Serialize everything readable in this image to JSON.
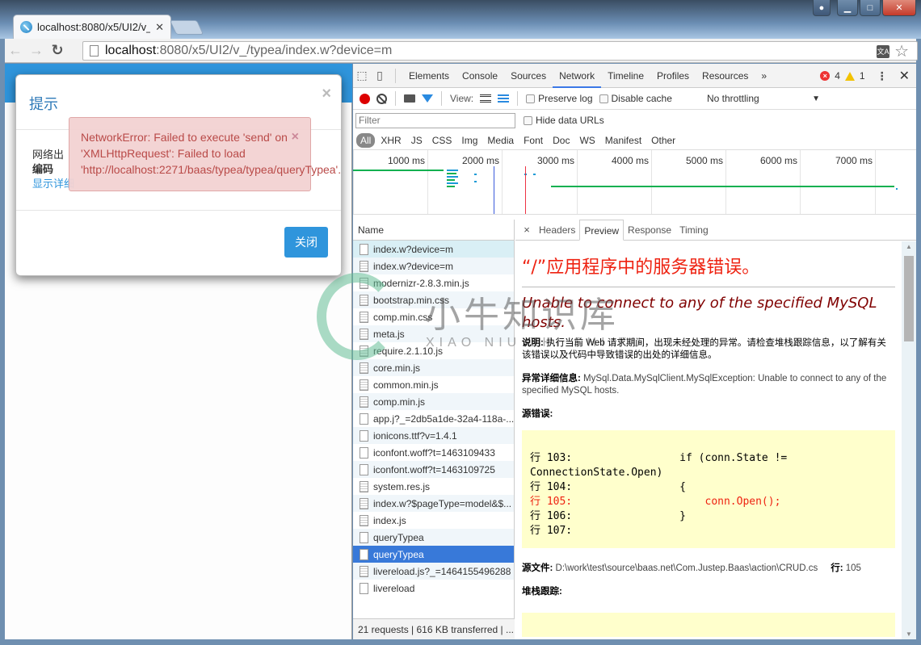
{
  "browser": {
    "tab_title": "localhost:8080/x5/UI2/v_",
    "url_host": "localhost",
    "url_rest": ":8080/x5/UI2/v_/typea/index.w?device=m",
    "translate_icon": "translate-icon",
    "bookmark_icon": "star-icon",
    "menu_icon": "hamburger-menu-icon"
  },
  "page": {
    "modal": {
      "title": "提示",
      "body_line1": "网络出",
      "body_line2_bold": "编码",
      "show_details_link": "显示详细",
      "close_button": "关闭"
    },
    "toast": {
      "message": "NetworkError: Failed to execute 'send' on 'XMLHttpRequest': Failed to load 'http://localhost:2271/baas/typea/typea/queryTypea'.",
      "close": "×"
    }
  },
  "devtools": {
    "tabs": [
      "Elements",
      "Console",
      "Sources",
      "Network",
      "Timeline",
      "Profiles",
      "Resources"
    ],
    "active_tab": "Network",
    "more_tabs": "»",
    "error_count": "4",
    "warning_count": "1",
    "network": {
      "view_label": "View:",
      "preserve_log": "Preserve log",
      "disable_cache": "Disable cache",
      "throttling": "No throttling",
      "filter_placeholder": "Filter",
      "hide_data_urls": "Hide data URLs",
      "types": [
        "All",
        "XHR",
        "JS",
        "CSS",
        "Img",
        "Media",
        "Font",
        "Doc",
        "WS",
        "Manifest",
        "Other"
      ],
      "active_type": "All",
      "timeline_ticks": [
        "1000 ms",
        "2000 ms",
        "3000 ms",
        "4000 ms",
        "5000 ms",
        "6000 ms",
        "7000 ms"
      ],
      "name_header": "Name",
      "requests": [
        {
          "name": "index.w?device=m",
          "icon": "blank"
        },
        {
          "name": "index.w?device=m",
          "icon": "doc"
        },
        {
          "name": "modernizr-2.8.3.min.js",
          "icon": "doc"
        },
        {
          "name": "bootstrap.min.css",
          "icon": "doc"
        },
        {
          "name": "comp.min.css",
          "icon": "doc"
        },
        {
          "name": "meta.js",
          "icon": "doc"
        },
        {
          "name": "require.2.1.10.js",
          "icon": "doc"
        },
        {
          "name": "core.min.js",
          "icon": "doc"
        },
        {
          "name": "common.min.js",
          "icon": "doc"
        },
        {
          "name": "comp.min.js",
          "icon": "doc"
        },
        {
          "name": "app.j?_=2db5a1de-32a4-118a-...",
          "icon": "blank"
        },
        {
          "name": "ionicons.ttf?v=1.4.1",
          "icon": "blank"
        },
        {
          "name": "iconfont.woff?t=1463109433",
          "icon": "blank"
        },
        {
          "name": "iconfont.woff?t=1463109725",
          "icon": "blank"
        },
        {
          "name": "system.res.js",
          "icon": "doc"
        },
        {
          "name": "index.w?$pageType=model&$...",
          "icon": "doc"
        },
        {
          "name": "index.js",
          "icon": "doc"
        },
        {
          "name": "queryTypea",
          "icon": "blank"
        },
        {
          "name": "queryTypea",
          "icon": "blank",
          "selected": true
        },
        {
          "name": "livereload.js?_=1464155496288",
          "icon": "doc"
        },
        {
          "name": "livereload",
          "icon": "blank"
        }
      ],
      "summary": "21 requests  |  616 KB transferred  |  ...",
      "detail_tabs": [
        "Headers",
        "Preview",
        "Response",
        "Timing"
      ],
      "active_detail_tab": "Preview"
    },
    "preview": {
      "heading": "“/”应用程序中的服务器错误。",
      "subheading": "Unable to connect to any of the specified MySQL hosts.",
      "desc_label": "说明:",
      "desc_text": "执行当前 Web 请求期间，出现未经处理的异常。请检查堆栈跟踪信息，以了解有关该错误以及代码中导致错误的出处的详细信息。",
      "exception_label": "异常详细信息:",
      "exception_text": "MySql.Data.MySqlClient.MySqlException: Unable to connect to any of the specified MySQL hosts.",
      "source_error_label": "源错误:",
      "code_lines": [
        {
          "text": "行 103:                 if (conn.State !=\nConnectionState.Open)",
          "error": false
        },
        {
          "text": "行 104:                 {",
          "error": false
        },
        {
          "text": "行 105:                     conn.Open();",
          "error": true
        },
        {
          "text": "行 106:                 }",
          "error": false
        },
        {
          "text": "行 107:",
          "error": false
        }
      ],
      "source_file_label": "源文件:",
      "source_file": "D:\\work\\test\\source\\baas.net\\Com.Justep.Baas\\action\\CRUD.cs",
      "line_label": "行:",
      "line_number": "105",
      "stack_trace_label": "堆栈跟踪:"
    }
  },
  "watermark": {
    "cn": "小牛知识库",
    "en": "XIAO NIU ZHI SHI KU"
  }
}
